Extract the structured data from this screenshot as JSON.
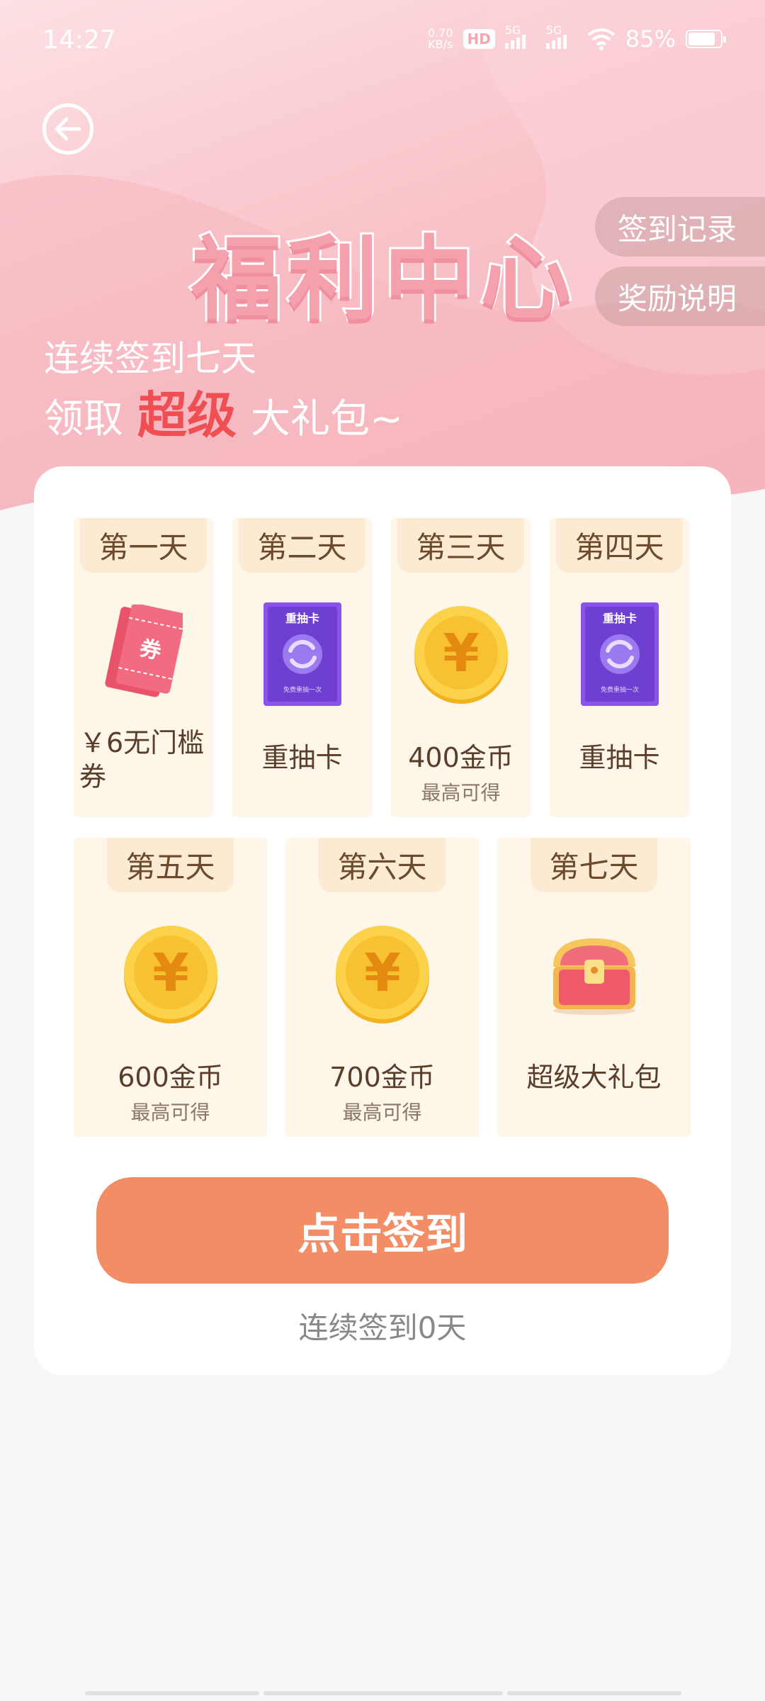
{
  "status_bar": {
    "time": "14:27",
    "net_speed_value": "0.70",
    "net_speed_unit": "KB/s",
    "hd_badge": "HD",
    "signal_1": "5G",
    "signal_2": "5G",
    "battery": "85%",
    "battery_level": 0.85
  },
  "header": {
    "title": "福利中心",
    "records_button": "签到记录",
    "rules_button": "奖励说明",
    "line1": "连续签到七天",
    "line2_prefix": "领取",
    "line2_highlight": "超级",
    "line2_suffix": "大礼包~"
  },
  "days": [
    {
      "tag": "第一天",
      "label": "￥6无门槛券",
      "sub": "",
      "icon": "coupon-icon"
    },
    {
      "tag": "第二天",
      "label": "重抽卡",
      "sub": "",
      "icon": "redraw-card-icon"
    },
    {
      "tag": "第三天",
      "label": "400金币",
      "sub": "最高可得",
      "icon": "gold-coin-icon"
    },
    {
      "tag": "第四天",
      "label": "重抽卡",
      "sub": "",
      "icon": "redraw-card-icon"
    },
    {
      "tag": "第五天",
      "label": "600金币",
      "sub": "最高可得",
      "icon": "gold-coin-icon"
    },
    {
      "tag": "第六天",
      "label": "700金币",
      "sub": "最高可得",
      "icon": "gold-coin-icon"
    },
    {
      "tag": "第七天",
      "label": "超级大礼包",
      "sub": "",
      "icon": "treasure-chest-icon"
    }
  ],
  "icons": {
    "coupon_text": "券",
    "redraw_title": "重抽卡",
    "redraw_caption": "免费重抽一次",
    "coin_symbol": "¥"
  },
  "checkin": {
    "button": "点击签到",
    "streak_text": "连续签到0天"
  },
  "colors": {
    "accent": "#f28d65",
    "highlight": "#ef4f53",
    "day_bg": "#fdf6e9",
    "tag_bg": "#fcebd2"
  }
}
